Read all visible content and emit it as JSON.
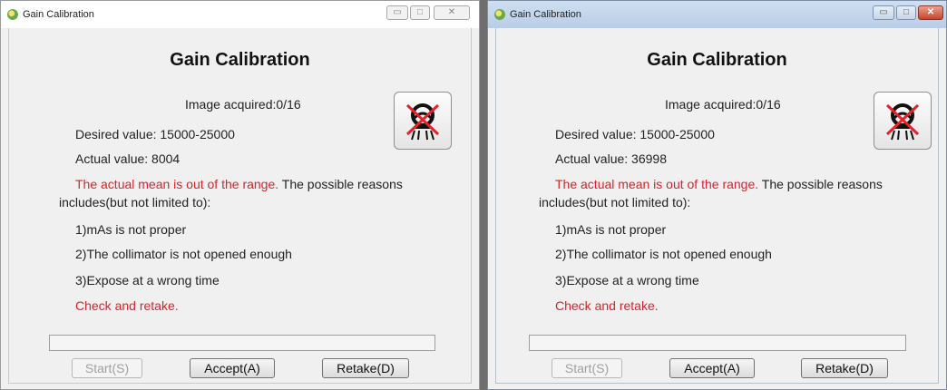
{
  "windows": [
    {
      "title": "Gain Calibration",
      "heading": "Gain Calibration",
      "image_acquired": "Image acquired:0/16",
      "desired": "Desired value: 15000-25000",
      "actual": "Actual value: 8004",
      "error_red": "The actual mean is out of the range.",
      "error_rest": " The possible reasons",
      "includes": "includes(but not limited to):",
      "reason1": "1)mAs is not proper",
      "reason2": "2)The collimator is not opened enough",
      "reason3": "3)Expose at a wrong time",
      "check": "Check and retake.",
      "start_label": "Start(S)",
      "accept_label": "Accept(A)",
      "retake_label": "Retake(D)",
      "controls": {
        "minimize": "▭",
        "maximize": "□",
        "close": "✕"
      }
    },
    {
      "title": "Gain Calibration",
      "heading": "Gain Calibration",
      "image_acquired": "Image acquired:0/16",
      "desired": "Desired value: 15000-25000",
      "actual": "Actual value: 36998",
      "error_red": "The actual mean is out of the range.",
      "error_rest": " The possible reasons",
      "includes": "includes(but not limited to):",
      "reason1": "1)mAs is not proper",
      "reason2": "2)The collimator is not opened enough",
      "reason3": "3)Expose at a wrong time",
      "check": "Check and retake.",
      "start_label": "Start(S)",
      "accept_label": "Accept(A)",
      "retake_label": "Retake(D)",
      "controls": {
        "minimize": "▭",
        "maximize": "□",
        "close": "✕"
      }
    }
  ],
  "colors": {
    "error": "#d8232a",
    "icon_cross": "#e8202a"
  },
  "icons": {
    "tube": "xray-tube-disabled-icon"
  }
}
